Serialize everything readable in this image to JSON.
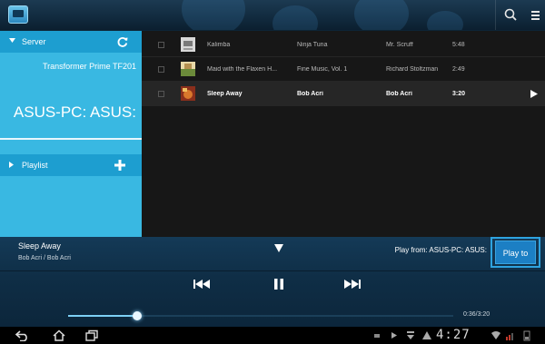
{
  "topbar": {
    "app_icon": "media-server-icon",
    "search_icon": "search-icon",
    "menu_icon": "overflow-menu-icon"
  },
  "sidebar": {
    "server_label": "Server",
    "server_items": [
      "Transformer Prime TF201",
      "ASUS-PC: ASUS:"
    ],
    "selected_server_index": 1,
    "playlist_label": "Playlist"
  },
  "tracks": [
    {
      "title": "Kalimba",
      "album": "Ninja Tuna",
      "artist": "Mr. Scruff",
      "duration": "5:48",
      "active": false
    },
    {
      "title": "Maid with the Flaxen H...",
      "album": "Fine Music, Vol. 1",
      "artist": "Richard Stoltzman",
      "duration": "2:49",
      "active": false
    },
    {
      "title": "Sleep Away",
      "album": "Bob Acri",
      "artist": "Bob Acri",
      "duration": "3:20",
      "active": true
    }
  ],
  "now_playing": {
    "title": "Sleep Away",
    "artist_album": "Bob Acri / Bob Acri",
    "play_from": "Play from: ASUS-PC: ASUS:",
    "play_to_label": "Play to",
    "time": "0:36/3:20",
    "progress_fraction": 0.18
  },
  "system_bar": {
    "clock": "4:27"
  },
  "colors": {
    "sidebar": "#39b8e2",
    "sidebar_header": "#1d9ed0",
    "accent": "#2ea3e0",
    "list_bg": "#171717"
  }
}
